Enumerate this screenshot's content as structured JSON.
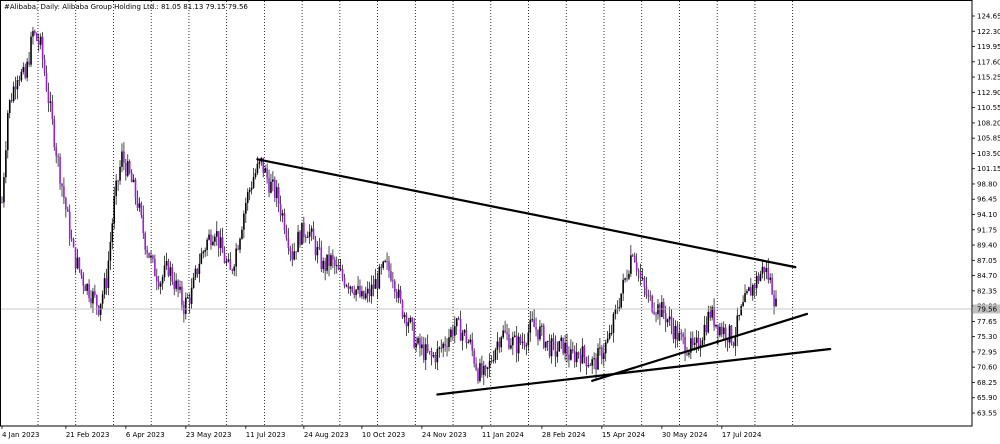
{
  "chart_data": {
    "type": "candlestick",
    "title": "#Alibaba, Daily:  Alibaba Group Holding Ltd.: 81.05 81.13 79.15 79.56",
    "symbol": "#Alibaba",
    "timeframe": "Daily",
    "instrument": "Alibaba Group Holding Ltd.",
    "ohlc_last": {
      "open": 81.05,
      "high": 81.13,
      "low": 79.15,
      "close": 79.56
    },
    "current_price_label": "79.56",
    "ylim": [
      63.55,
      124.65
    ],
    "y_ticks": [
      "124.65",
      "122.30",
      "119.95",
      "117.60",
      "115.25",
      "112.90",
      "110.55",
      "108.20",
      "105.85",
      "103.50",
      "101.15",
      "98.80",
      "96.45",
      "94.10",
      "91.75",
      "89.40",
      "87.05",
      "84.70",
      "82.35",
      "80.00",
      "77.65",
      "75.30",
      "72.95",
      "70.60",
      "68.25",
      "65.90",
      "63.55"
    ],
    "x_ticks": [
      "4 Jan 2023",
      "21 Feb 2023",
      "6 Apr 2023",
      "23 May 2023",
      "11 Jul 2023",
      "24 Aug 2023",
      "10 Oct 2023",
      "24 Nov 2023",
      "11 Jan 2024",
      "28 Feb 2024",
      "15 Apr 2024",
      "30 May 2024",
      "17 Jul 2024"
    ],
    "x_tick_index": [
      0,
      33,
      64,
      95,
      126,
      156,
      186,
      217,
      248,
      279,
      310,
      341,
      372
    ],
    "total_bars": 406,
    "grid": "vertical-dotted",
    "bull_color": "#000000",
    "bear_color": "#9a1fd6",
    "price_path": [
      [
        0,
        96
      ],
      [
        3,
        110
      ],
      [
        8,
        116
      ],
      [
        12,
        115
      ],
      [
        16,
        122
      ],
      [
        20,
        120
      ],
      [
        24,
        112
      ],
      [
        28,
        104
      ],
      [
        33,
        95
      ],
      [
        37,
        88
      ],
      [
        42,
        84
      ],
      [
        46,
        82
      ],
      [
        50,
        80
      ],
      [
        54,
        84
      ],
      [
        58,
        96
      ],
      [
        62,
        103
      ],
      [
        66,
        100
      ],
      [
        70,
        96
      ],
      [
        74,
        90
      ],
      [
        78,
        86
      ],
      [
        82,
        84
      ],
      [
        86,
        86
      ],
      [
        90,
        83
      ],
      [
        94,
        80
      ],
      [
        98,
        82
      ],
      [
        102,
        87
      ],
      [
        106,
        90
      ],
      [
        110,
        92
      ],
      [
        114,
        88
      ],
      [
        118,
        85
      ],
      [
        122,
        90
      ],
      [
        126,
        96
      ],
      [
        130,
        100
      ],
      [
        134,
        102
      ],
      [
        138,
        99
      ],
      [
        142,
        97
      ],
      [
        146,
        93
      ],
      [
        150,
        88
      ],
      [
        154,
        91
      ],
      [
        158,
        92
      ],
      [
        162,
        89
      ],
      [
        166,
        86
      ],
      [
        170,
        87
      ],
      [
        174,
        85
      ],
      [
        178,
        84
      ],
      [
        182,
        83
      ],
      [
        186,
        81
      ],
      [
        190,
        82
      ],
      [
        194,
        84
      ],
      [
        198,
        86
      ],
      [
        202,
        85
      ],
      [
        206,
        80
      ],
      [
        210,
        78
      ],
      [
        214,
        74
      ],
      [
        218,
        73
      ],
      [
        222,
        72
      ],
      [
        226,
        73
      ],
      [
        230,
        75
      ],
      [
        234,
        77
      ],
      [
        238,
        76
      ],
      [
        242,
        74
      ],
      [
        246,
        70
      ],
      [
        250,
        69
      ],
      [
        254,
        73
      ],
      [
        258,
        76
      ],
      [
        262,
        75
      ],
      [
        266,
        74
      ],
      [
        270,
        75
      ],
      [
        274,
        77
      ],
      [
        278,
        76
      ],
      [
        282,
        74
      ],
      [
        286,
        73
      ],
      [
        290,
        74
      ],
      [
        294,
        72
      ],
      [
        298,
        73
      ],
      [
        302,
        72
      ],
      [
        306,
        71
      ],
      [
        310,
        73
      ],
      [
        314,
        75
      ],
      [
        318,
        80
      ],
      [
        322,
        84
      ],
      [
        326,
        89
      ],
      [
        330,
        84
      ],
      [
        334,
        81
      ],
      [
        338,
        80
      ],
      [
        342,
        79
      ],
      [
        346,
        77
      ],
      [
        350,
        75
      ],
      [
        354,
        74
      ],
      [
        358,
        73
      ],
      [
        362,
        76
      ],
      [
        366,
        79
      ],
      [
        370,
        77
      ],
      [
        374,
        76
      ],
      [
        378,
        75
      ],
      [
        382,
        79
      ],
      [
        386,
        82
      ],
      [
        390,
        84
      ],
      [
        394,
        86
      ],
      [
        398,
        83
      ],
      [
        400,
        80
      ]
    ],
    "trendlines": [
      {
        "name": "resistance",
        "from": [
          132,
          102.6
        ],
        "to": [
          410,
          86.0
        ]
      },
      {
        "name": "support-steep",
        "from": [
          305,
          68.5
        ],
        "to": [
          416,
          78.8
        ]
      },
      {
        "name": "support-shallow",
        "from": [
          225,
          66.4
        ],
        "to": [
          428,
          73.4
        ]
      }
    ]
  }
}
